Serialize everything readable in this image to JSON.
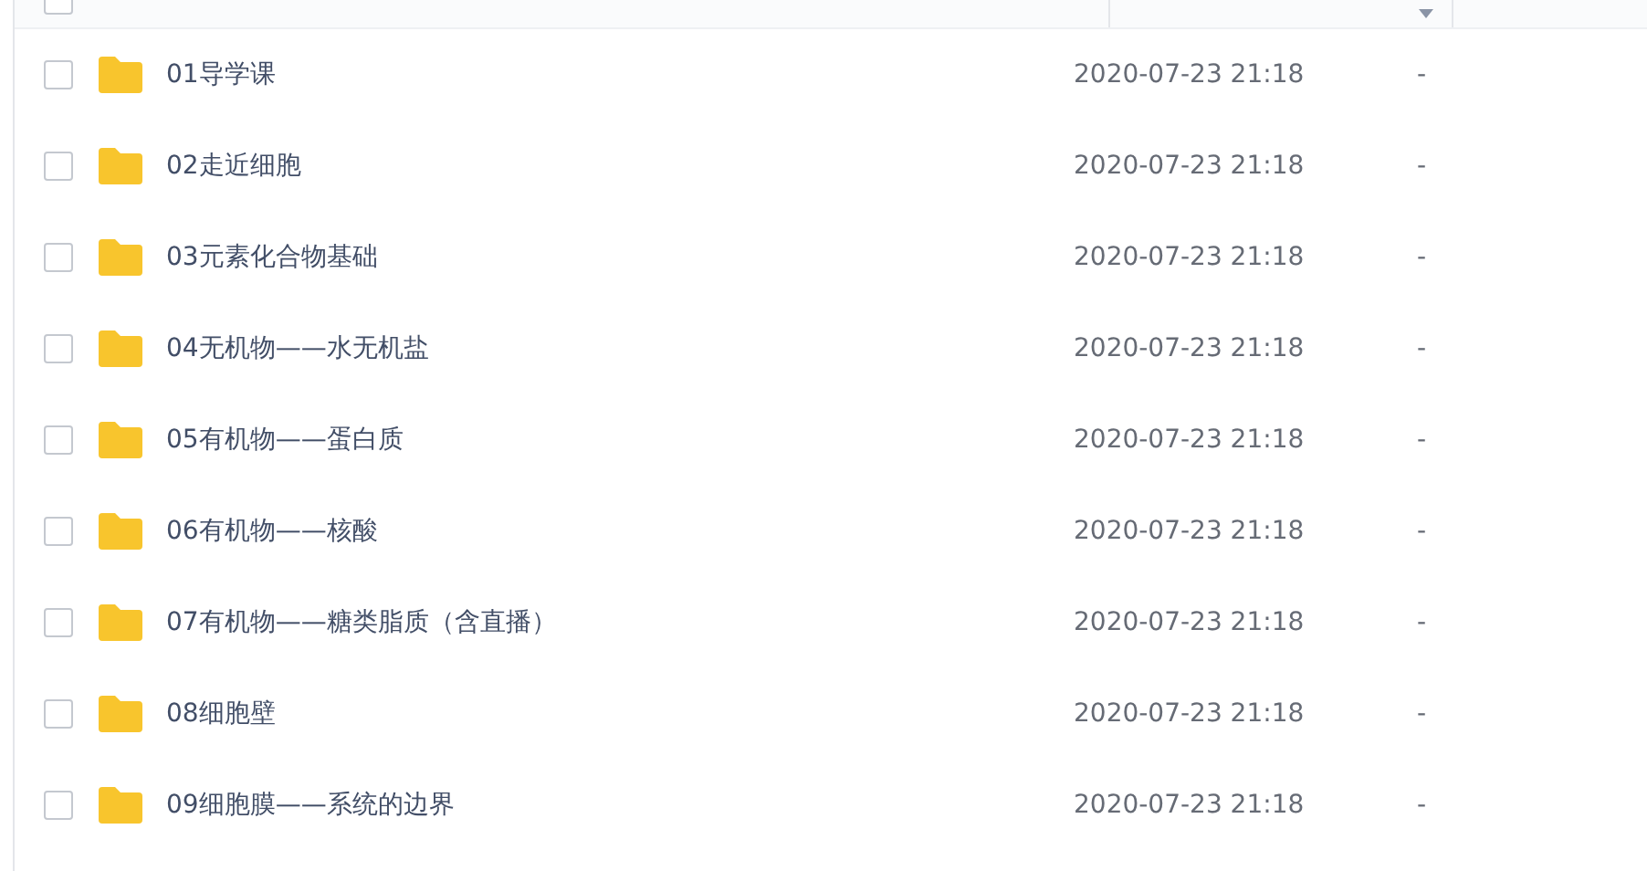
{
  "header": {
    "checked": false
  },
  "files": [
    {
      "name": "01导学课",
      "modified": "2020-07-23 21:18",
      "size": "-",
      "checked": false
    },
    {
      "name": "02走近细胞",
      "modified": "2020-07-23 21:18",
      "size": "-",
      "checked": false
    },
    {
      "name": "03元素化合物基础",
      "modified": "2020-07-23 21:18",
      "size": "-",
      "checked": false
    },
    {
      "name": "04无机物——水无机盐",
      "modified": "2020-07-23 21:18",
      "size": "-",
      "checked": false
    },
    {
      "name": "05有机物——蛋白质",
      "modified": "2020-07-23 21:18",
      "size": "-",
      "checked": false
    },
    {
      "name": "06有机物——核酸",
      "modified": "2020-07-23 21:18",
      "size": "-",
      "checked": false
    },
    {
      "name": "07有机物——糖类脂质（含直播）",
      "modified": "2020-07-23 21:18",
      "size": "-",
      "checked": false
    },
    {
      "name": "08细胞壁",
      "modified": "2020-07-23 21:18",
      "size": "-",
      "checked": false
    },
    {
      "name": "09细胞膜——系统的边界",
      "modified": "2020-07-23 21:18",
      "size": "-",
      "checked": false
    }
  ]
}
